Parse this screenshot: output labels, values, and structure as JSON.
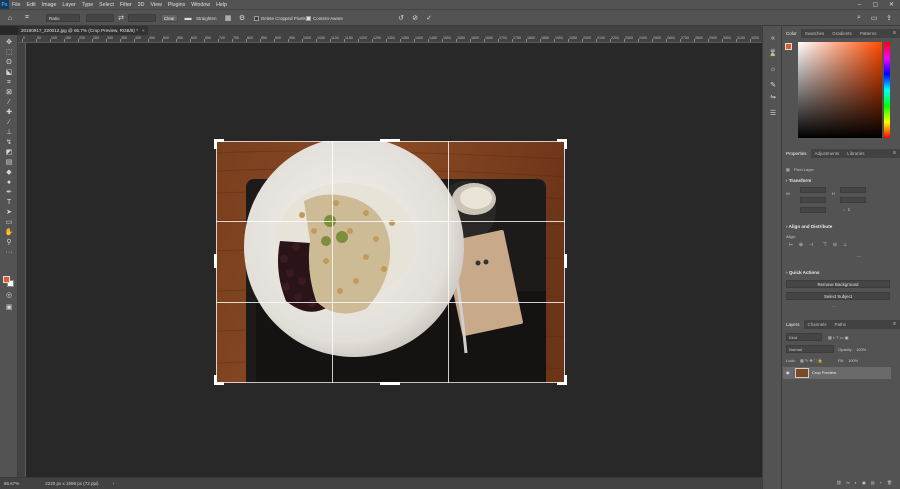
{
  "menubar": {
    "logo": "Ps",
    "items": [
      "File",
      "Edit",
      "Image",
      "Layer",
      "Type",
      "Select",
      "Filter",
      "3D",
      "View",
      "Plugins",
      "Window",
      "Help"
    ]
  },
  "options": {
    "ratio": "Ratio",
    "clear": "Clear",
    "straighten": "Straighten",
    "delete_cropped": "Delete Cropped Pixels",
    "content_aware": "Content-Aware"
  },
  "document": {
    "tab_title": "20190917_220012.jpg @ 66.7% (Crop Preview, RGB/8) *",
    "tab_close": "×"
  },
  "ruler_labels": [
    "0",
    "50",
    "100",
    "150",
    "200",
    "250",
    "300",
    "350",
    "400",
    "450",
    "500",
    "550",
    "600",
    "650",
    "700",
    "750",
    "800",
    "850",
    "900",
    "950",
    "1000",
    "1050",
    "1100",
    "1150",
    "1200",
    "1250",
    "1300",
    "1350",
    "1400",
    "1450",
    "1500",
    "1550",
    "1600",
    "1650",
    "1700",
    "1750",
    "1800",
    "1850",
    "1900",
    "1950",
    "2000",
    "2100",
    "2200",
    "2300",
    "2400",
    "2500",
    "2600",
    "2700",
    "2800",
    "2900",
    "3000",
    "3100",
    "3200"
  ],
  "status": {
    "zoom": "66.67%",
    "dims": "2220 px x 1559 px (72 ppi)",
    "arrow": "›"
  },
  "color_panel": {
    "tabs": [
      "Color",
      "Swatches",
      "Gradients",
      "Patterns"
    ],
    "fg_color": "#e25a24",
    "hue_color": "#ff4a00"
  },
  "properties_panel": {
    "tabs": [
      "Properties",
      "Adjustments",
      "Libraries"
    ],
    "layer_type": "Pixel Layer",
    "transform": "Transform",
    "align": "Align and Distribute",
    "align_label": "Align:",
    "quick_actions": "Quick Actions",
    "remove_bg": "Remove Background",
    "select_subject": "Select Subject",
    "more": "···"
  },
  "layers_panel": {
    "tabs": [
      "Layers",
      "Channels",
      "Paths"
    ],
    "search": "Kind",
    "blend": "Normal",
    "opacity_label": "Opacity:",
    "opacity": "100%",
    "lock_label": "Lock:",
    "fill_label": "Fill:",
    "fill": "100%",
    "layer_name": "Crop Preview"
  },
  "bottom_icons": [
    "fx",
    "◐",
    "▣",
    "▤",
    "+",
    "🗑"
  ]
}
